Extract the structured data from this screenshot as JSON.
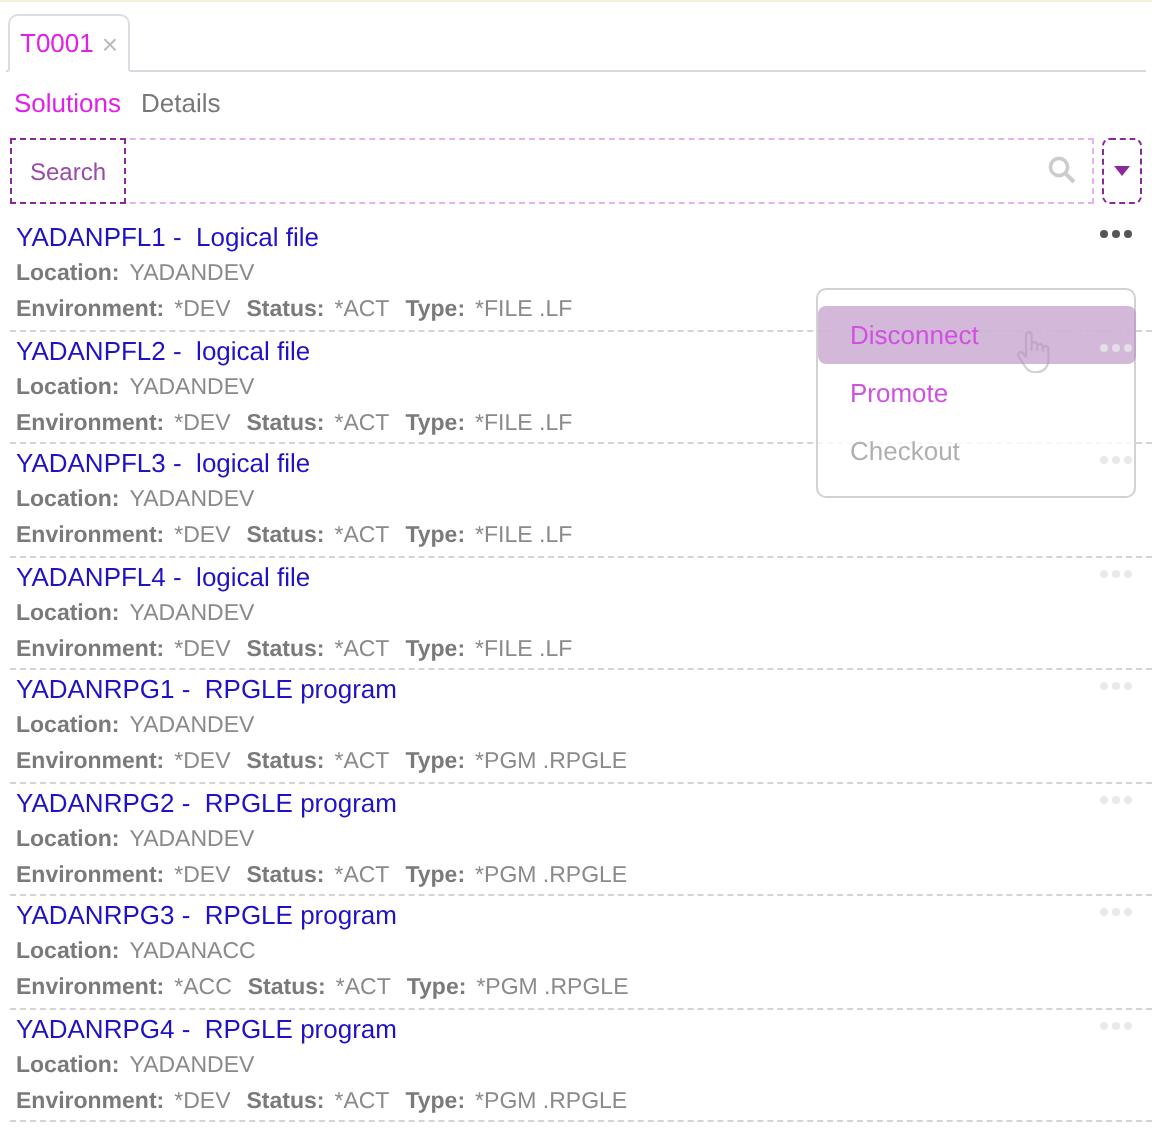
{
  "tab": {
    "label": "T0001",
    "close": "×",
    "selected": true
  },
  "subtabs": [
    {
      "label": "Solutions",
      "selected": true
    },
    {
      "label": "Details",
      "selected": false
    }
  ],
  "search": {
    "placeholder": "Search"
  },
  "rows": [
    {
      "title": "YADANPFL1 -  Logical file",
      "location": [
        "Location:",
        "YADANDEV"
      ],
      "fields": [
        [
          "Environment:",
          "*DEV"
        ],
        [
          "Status:",
          "*ACT"
        ],
        [
          "Type:",
          "*FILE .LF"
        ]
      ],
      "menu_open": true
    },
    {
      "title": "YADANPFL2 -  logical file",
      "location": [
        "Location:",
        "YADANDEV"
      ],
      "fields": [
        [
          "Environment:",
          "*DEV"
        ],
        [
          "Status:",
          "*ACT"
        ],
        [
          "Type:",
          "*FILE .LF"
        ]
      ],
      "menu_open": false
    },
    {
      "title": "YADANPFL3 -  logical file",
      "location": [
        "Location:",
        "YADANDEV"
      ],
      "fields": [
        [
          "Environment:",
          "*DEV"
        ],
        [
          "Status:",
          "*ACT"
        ],
        [
          "Type:",
          "*FILE .LF"
        ]
      ],
      "menu_open": false
    },
    {
      "title": "YADANPFL4 -  logical file",
      "location": [
        "Location:",
        "YADANDEV"
      ],
      "fields": [
        [
          "Environment:",
          "*DEV"
        ],
        [
          "Status:",
          "*ACT"
        ],
        [
          "Type:",
          "*FILE .LF"
        ]
      ],
      "menu_open": false
    },
    {
      "title": "YADANRPG1 -  RPGLE program",
      "location": [
        "Location:",
        "YADANDEV"
      ],
      "fields": [
        [
          "Environment:",
          "*DEV"
        ],
        [
          "Status:",
          "*ACT"
        ],
        [
          "Type:",
          "*PGM .RPGLE"
        ]
      ],
      "menu_open": false
    },
    {
      "title": "YADANRPG2 -  RPGLE program",
      "location": [
        "Location:",
        "YADANDEV"
      ],
      "fields": [
        [
          "Environment:",
          "*DEV"
        ],
        [
          "Status:",
          "*ACT"
        ],
        [
          "Type:",
          "*PGM .RPGLE"
        ]
      ],
      "menu_open": false
    },
    {
      "title": "YADANRPG3 -  RPGLE program",
      "location": [
        "Location:",
        "YADANACC"
      ],
      "fields": [
        [
          "Environment:",
          "*ACC"
        ],
        [
          "Status:",
          "*ACT"
        ],
        [
          "Type:",
          "*PGM .RPGLE"
        ]
      ],
      "menu_open": false
    },
    {
      "title": "YADANRPG4 -  RPGLE program",
      "location": [
        "Location:",
        "YADANDEV"
      ],
      "fields": [
        [
          "Environment:",
          "*DEV"
        ],
        [
          "Status:",
          "*ACT"
        ],
        [
          "Type:",
          "*PGM .RPGLE"
        ]
      ],
      "menu_open": false
    }
  ],
  "menu": [
    {
      "label": "Disconnect",
      "hovered": true,
      "disabled": false
    },
    {
      "label": "Promote",
      "hovered": false,
      "disabled": false
    },
    {
      "label": "Checkout",
      "hovered": false,
      "disabled": true
    }
  ]
}
